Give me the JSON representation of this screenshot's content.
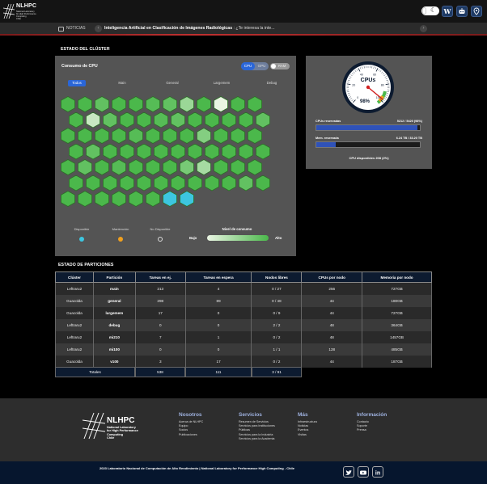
{
  "header": {
    "logo": {
      "title": "NLHPC",
      "subtitle": "National Laboratory\nfor High Performance\nComputing\nChile"
    },
    "buttons": [
      {
        "name": "theme-toggle"
      },
      {
        "name": "wiki-button",
        "label": "W"
      },
      {
        "name": "bot-button"
      },
      {
        "name": "location-button"
      }
    ]
  },
  "news": {
    "label": "NOTICIAS",
    "headline": "Inteligencia Artificial en Clasificación de Imágenes Radiológicas",
    "snippet": ": ¿Te interesa la inte..."
  },
  "cluster": {
    "section_title": "ESTADO DEL CLÚSTER",
    "panel_title": "Consumo de CPU",
    "type_options": [
      "CPU",
      "GPU"
    ],
    "type_selected": "CPU",
    "ram_label": "RAM",
    "partition_tabs": [
      "Todos",
      "Main",
      "General",
      "Largemem",
      "Debug"
    ],
    "partition_selected": "Todos",
    "legend": {
      "available": "Disponible",
      "maintenance": "Mantención",
      "unavailable": "No Disponible",
      "consumption_title": "Nivel de consumo",
      "low": "Bajo",
      "high": "Alto"
    },
    "colors": {
      "available": "#3dc6e0",
      "maintenance": "#f0a01e",
      "high": "#4bb84b",
      "low": "#eaf5e3"
    },
    "node_rows": [
      [
        0.8,
        0.7,
        0.6,
        0.75,
        0.7,
        0.65,
        0.6,
        0.35,
        0.7,
        0.0,
        0.7,
        0.7
      ],
      [
        0.7,
        0.15,
        0.6,
        0.7,
        0.7,
        0.65,
        0.6,
        0.7,
        0.7,
        0.7,
        0.7,
        0.6
      ],
      [
        0.7,
        0.7,
        0.7,
        0.7,
        0.65,
        0.7,
        0.7,
        0.7,
        0.45,
        0.7,
        0.7,
        0.7
      ],
      [
        0.75,
        0.6,
        0.7,
        0.7,
        0.7,
        0.7,
        0.7,
        0.7,
        0.7,
        0.7,
        0.7,
        0.7
      ],
      [
        0.7,
        0.6,
        0.7,
        0.65,
        0.7,
        0.7,
        0.7,
        0.5,
        0.3,
        0.7,
        0.7,
        0.7
      ],
      [
        0.7,
        0.7,
        0.7,
        0.7,
        0.7,
        0.7,
        0.7,
        0.7,
        0.7,
        0.7,
        0.6,
        0.7
      ],
      [
        0.7,
        0.7,
        0.7,
        0.7,
        0.7,
        0.7,
        "available",
        "available"
      ]
    ]
  },
  "gauge": {
    "label": "CPUs",
    "percent": "98%",
    "fraction": 0.98,
    "ticks": [
      "0",
      "20",
      "40",
      "60",
      "80",
      "100"
    ],
    "cpus_reserved_label": "CPUs reservadas",
    "cpus_reserved_value": "5212 / 5420 (98%)",
    "cpus_reserved_fraction": 0.98,
    "mem_reserved_label": "Mem. reservada",
    "mem_reserved_value": "6.24 TB / 33.20 TB",
    "mem_reserved_fraction": 0.19,
    "cpu_available": "CPU disponibles 208 (2%)"
  },
  "partitions": {
    "section_title": "ESTADO DE PARTICIONES",
    "headers": [
      "Clúster",
      "Partición",
      "Tareas en ej.",
      "Tareas en espera",
      "Nodos libres",
      "CPUs por nodo",
      "Memoria por nodo"
    ],
    "rows": [
      [
        "Leftraru2",
        "main",
        "213",
        "4",
        "0 / 27",
        "256",
        "727GB"
      ],
      [
        "Guacolda",
        "general",
        "298",
        "89",
        "0 / 48",
        "44",
        "180GB"
      ],
      [
        "Guacolda",
        "largemem",
        "17",
        "0",
        "0 / 9",
        "44",
        "727GB"
      ],
      [
        "Leftraru2",
        "debug",
        "0",
        "0",
        "2 / 2",
        "48",
        "364GB"
      ],
      [
        "Leftraru2",
        "mi210",
        "7",
        "1",
        "0 / 2",
        "48",
        "1457GB"
      ],
      [
        "Leftraru2",
        "mi100",
        "0",
        "0",
        "1 / 1",
        "128",
        "485GB"
      ],
      [
        "Guacolda",
        "v100",
        "3",
        "17",
        "0 / 2",
        "44",
        "187GB"
      ]
    ],
    "totals": {
      "label": "Totales",
      "running": "538",
      "waiting": "111",
      "free": "3 / 91"
    }
  },
  "footer": {
    "logo_title": "NLHPC",
    "logo_sub": "National Laboratory\nfor High Performance\nComputing\nChile",
    "columns": [
      {
        "title": "Nosotros",
        "links": [
          "Acerca de NLHPC",
          "Equipo",
          "Socios",
          "Publicaciones"
        ]
      },
      {
        "title": "Servicios",
        "links": [
          "Resumen de Servicios",
          "Servicios para Instituciones",
          "Públicas",
          "Servicios para la Industria",
          "Servicios para la Academia"
        ]
      },
      {
        "title": "Más",
        "links": [
          "Infraestructura",
          "Noticias",
          "Eventos",
          "Visitas"
        ]
      },
      {
        "title": "Información",
        "links": [
          "Contacto",
          "Soporte",
          "Prensa"
        ]
      }
    ],
    "copyright": "2023 Laboratorio Nacional de Computación de Alto Rendimiento | National Laboratory for Performance High Computing - Chile",
    "social": [
      "twitter-icon",
      "youtube-icon",
      "linkedin-icon"
    ]
  }
}
